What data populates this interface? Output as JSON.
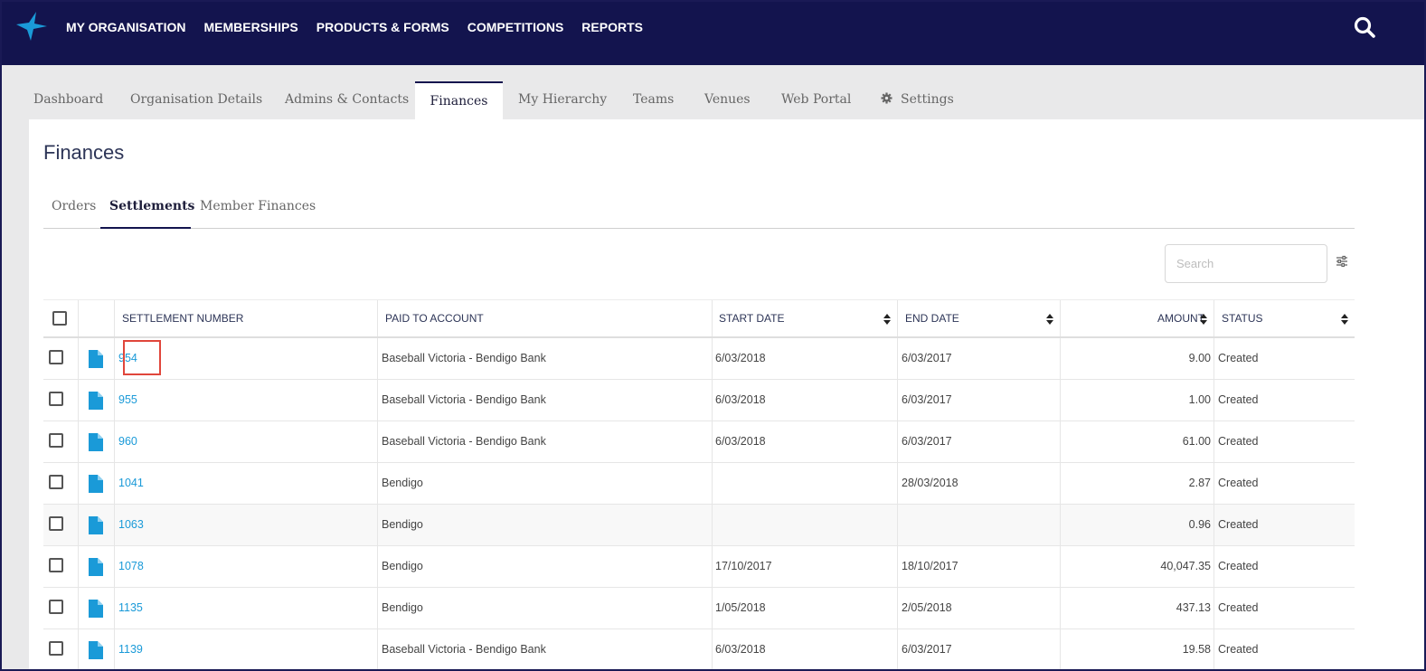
{
  "colors": {
    "nav_bg": "#13144e",
    "accent": "#1a9ad8",
    "highlight": "#e0463b"
  },
  "nav": {
    "items": [
      "MY ORGANISATION",
      "MEMBERSHIPS",
      "PRODUCTS & FORMS",
      "COMPETITIONS",
      "REPORTS"
    ],
    "logo_icon": "star-logo-icon",
    "search_icon": "search-icon"
  },
  "tabs": [
    "Dashboard",
    "Organisation Details",
    "Admins & Contacts",
    "Finances",
    "My Hierarchy",
    "Teams",
    "Venues",
    "Web Portal",
    "Settings"
  ],
  "active_tab": "Finances",
  "page": {
    "title": "Finances",
    "subtabs": [
      "Orders",
      "Settlements",
      "Member Finances"
    ],
    "active_subtab": "Settlements",
    "search_placeholder": "Search"
  },
  "table": {
    "headers": [
      "SETTLEMENT NUMBER",
      "PAID TO ACCOUNT",
      "START DATE",
      "END DATE",
      "AMOUNT",
      "STATUS"
    ],
    "rows": [
      [
        "954",
        "Baseball Victoria - Bendigo Bank",
        "6/03/2018",
        "6/03/2017",
        "9.00",
        "Created"
      ],
      [
        "955",
        "Baseball Victoria - Bendigo Bank",
        "6/03/2018",
        "6/03/2017",
        "1.00",
        "Created"
      ],
      [
        "960",
        "Baseball Victoria - Bendigo Bank",
        "6/03/2018",
        "6/03/2017",
        "61.00",
        "Created"
      ],
      [
        "1041",
        "Bendigo",
        "",
        "28/03/2018",
        "2.87",
        "Created"
      ],
      [
        "1063",
        "Bendigo",
        "",
        "",
        "0.96",
        "Created"
      ],
      [
        "1078",
        "Bendigo",
        "17/10/2017",
        "18/10/2017",
        "40,047.35",
        "Created"
      ],
      [
        "1135",
        "Bendigo",
        "1/05/2018",
        "2/05/2018",
        "437.13",
        "Created"
      ],
      [
        "1139",
        "Baseball Victoria - Bendigo Bank",
        "6/03/2018",
        "6/03/2017",
        "19.58",
        "Created"
      ]
    ]
  }
}
